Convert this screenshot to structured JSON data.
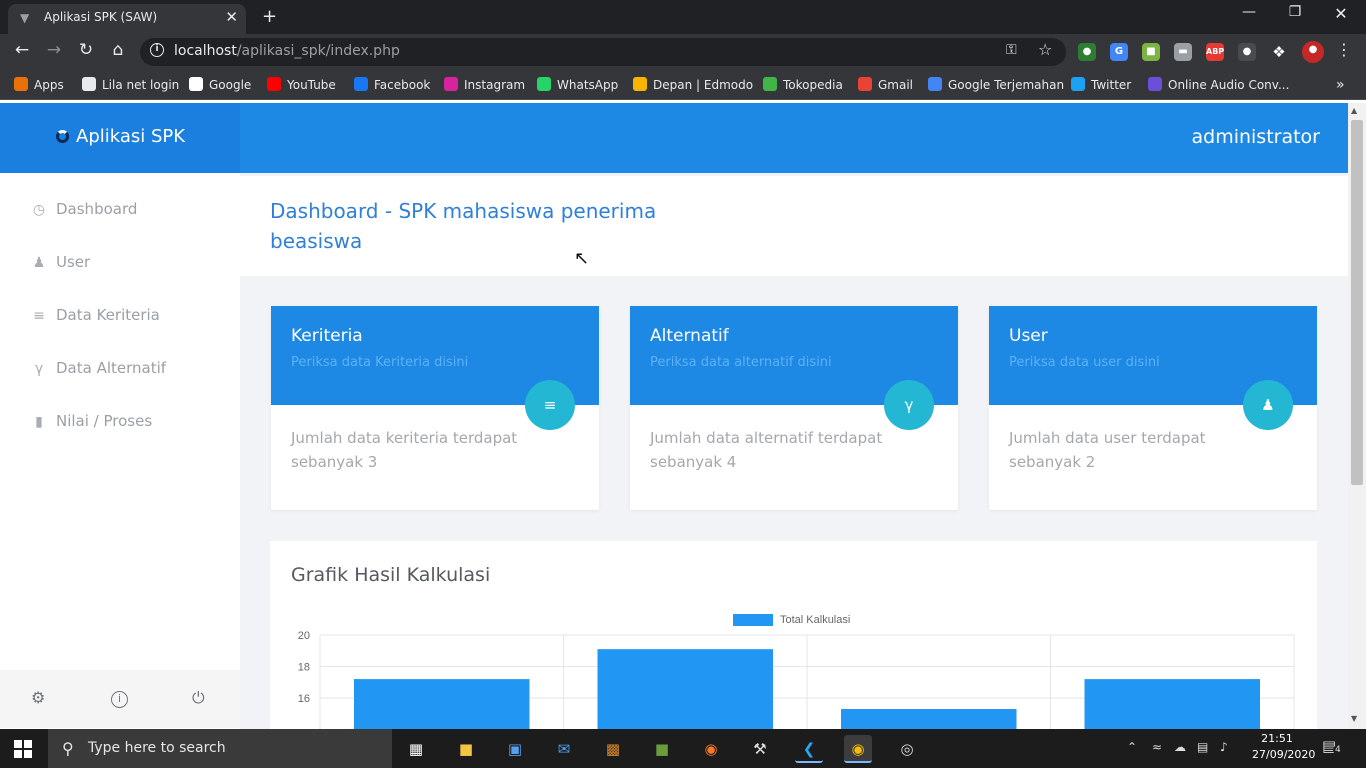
{
  "browser": {
    "tab_title": "Aplikasi SPK (SAW)",
    "url_host": "localhost",
    "url_path": "/aplikasi_spk/index.php",
    "bookmarks": [
      {
        "label": "Apps",
        "icon": "apps-grid-icon",
        "color": "#e8710a"
      },
      {
        "label": "Lila net login",
        "icon": "globe-icon",
        "color": "#e8eaed"
      },
      {
        "label": "Google",
        "icon": "google-icon",
        "color": "#ffffff"
      },
      {
        "label": "YouTube",
        "icon": "youtube-icon",
        "color": "#ff0000"
      },
      {
        "label": "Facebook",
        "icon": "facebook-icon",
        "color": "#1877f2"
      },
      {
        "label": "Instagram",
        "icon": "instagram-icon",
        "color": "#d6249f"
      },
      {
        "label": "WhatsApp",
        "icon": "whatsapp-icon",
        "color": "#25d366"
      },
      {
        "label": "Depan | Edmodo",
        "icon": "edmodo-icon",
        "color": "#f7b500"
      },
      {
        "label": "Tokopedia",
        "icon": "tokopedia-icon",
        "color": "#42b549"
      },
      {
        "label": "Gmail",
        "icon": "gmail-icon",
        "color": "#ea4335"
      },
      {
        "label": "Google Terjemahan",
        "icon": "translate-icon",
        "color": "#4285f4"
      },
      {
        "label": "Twitter",
        "icon": "twitter-icon",
        "color": "#1da1f2"
      },
      {
        "label": "Online Audio Conv...",
        "icon": "audio-converter-icon",
        "color": "#6b4fd8"
      }
    ]
  },
  "app": {
    "brand": "Aplikasi SPK",
    "user": "administrator",
    "accent": "#1e88e5",
    "badge_color": "#23b7d3"
  },
  "sidebar": {
    "items": [
      {
        "label": "Dashboard",
        "icon": "dashboard-icon"
      },
      {
        "label": "User",
        "icon": "users-icon"
      },
      {
        "label": "Data Keriteria",
        "icon": "playlist-check-icon"
      },
      {
        "label": "Data Alternatif",
        "icon": "fork-icon"
      },
      {
        "label": "Nilai / Proses",
        "icon": "bar-chart-icon"
      }
    ],
    "footer": [
      "settings-icon",
      "info-icon",
      "power-icon"
    ]
  },
  "page": {
    "title": "Dashboard - SPK mahasiswa penerima beasiswa"
  },
  "cards": [
    {
      "title": "Keriteria",
      "subtitle": "Periksa data Keriteria disini",
      "body": "Jumlah data keriteria terdapat sebanyak 3",
      "icon": "playlist-check-icon"
    },
    {
      "title": "Alternatif",
      "subtitle": "Periksa data alternatif disini",
      "body": "Jumlah data alternatif terdapat sebanyak 4",
      "icon": "fork-icon"
    },
    {
      "title": "User",
      "subtitle": "Periksa data user disini",
      "body": "Jumlah data user terdapat sebanyak 2",
      "icon": "users-icon"
    }
  ],
  "chart_title": "Grafik Hasil Kalkulasi",
  "chart_data": {
    "type": "bar",
    "categories": [
      "",
      "",
      "",
      ""
    ],
    "series": [
      {
        "name": "Total Kalkulasi",
        "values": [
          17.2,
          19.1,
          15.3,
          17.2
        ],
        "color": "#2196f3"
      }
    ],
    "yticks": [
      20,
      18,
      16,
      14
    ],
    "ylim": [
      14,
      20
    ],
    "grid": true,
    "legend": "top"
  },
  "taskbar": {
    "search_placeholder": "Type here to search",
    "time": "21:51",
    "date": "27/09/2020",
    "notifications": "4"
  }
}
